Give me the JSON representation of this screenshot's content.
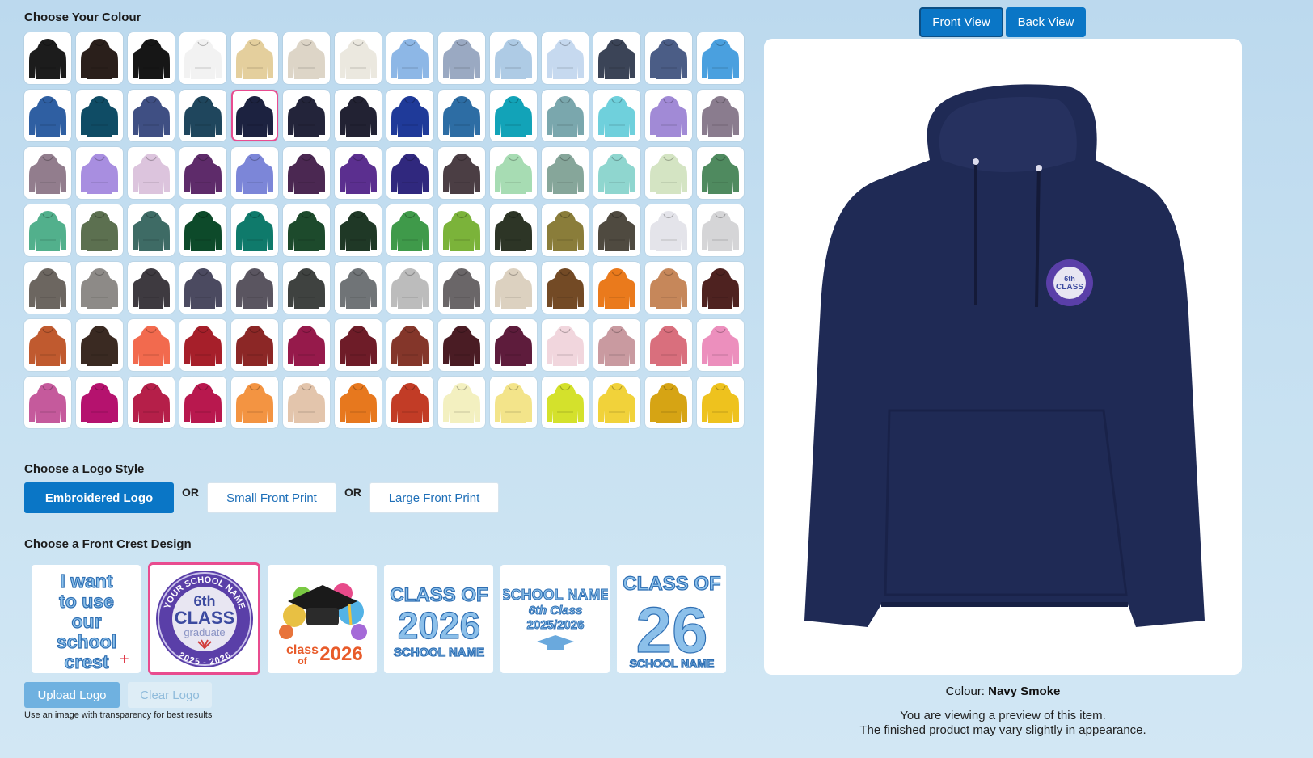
{
  "colour_section": {
    "heading": "Choose Your Colour",
    "selected_index": 18,
    "swatches": [
      "#1c1c1c",
      "#2a1f1b",
      "#161616",
      "#f2f2f2",
      "#e4cf9d",
      "#ddd5c7",
      "#ebe8df",
      "#8db7e6",
      "#9aa9c2",
      "#aecbe5",
      "#c6d9ef",
      "#3b4457",
      "#4b5d86",
      "#4aa0df",
      "#2f5fa2",
      "#0f4c65",
      "#3f4f83",
      "#1f465d",
      "#1c2240",
      "#23243a",
      "#222233",
      "#1f3a99",
      "#2d6da4",
      "#12a3b8",
      "#7aa7ad",
      "#6fd0dc",
      "#a18ad6",
      "#8a7c8e",
      "#927d8d",
      "#a88ee0",
      "#dcc4dd",
      "#5e2b6a",
      "#7c86d8",
      "#4b2852",
      "#5b2f8f",
      "#30287e",
      "#4b3e44",
      "#a7dcb3",
      "#86a69a",
      "#8fd6cf",
      "#d4e4c3",
      "#4f8a5f",
      "#52b08c",
      "#5c7050",
      "#3e6b65",
      "#0d4a2a",
      "#0f7a6b",
      "#1d4a2c",
      "#1f3826",
      "#3f9a4a",
      "#7bb33a",
      "#2d3526",
      "#8a7d3a",
      "#4f4a40",
      "#e4e4ea",
      "#d5d5d7",
      "#6c6660",
      "#8d8a87",
      "#3e3a40",
      "#4b4a60",
      "#5a5560",
      "#3f4240",
      "#707477",
      "#bcbcbc",
      "#6a6668",
      "#dcd1c0",
      "#734a25",
      "#ea7a1c",
      "#c6875a",
      "#4e2220",
      "#c05a2f",
      "#3a2a22",
      "#f26a4e",
      "#a61f2a",
      "#8c2726",
      "#961a4b",
      "#6e1c28",
      "#84362a",
      "#4a1c24",
      "#5e1c3c",
      "#f1d6dd",
      "#c99aa0",
      "#d96f7d",
      "#ec8fbd",
      "#c55a9c",
      "#b5126e",
      "#b51f49",
      "#b8184e",
      "#f39442",
      "#e3c5ac",
      "#e7781e",
      "#c23c26",
      "#f3f0c0",
      "#f3e48a",
      "#d4e12c",
      "#f1d23a",
      "#d6a414",
      "#eec21e"
    ]
  },
  "logo_style": {
    "heading": "Choose a Logo Style",
    "or_label": "OR",
    "options": [
      "Embroidered Logo",
      "Small Front Print",
      "Large Front Print"
    ],
    "selected": "Embroidered Logo"
  },
  "crest_section": {
    "heading": "Choose a Front Crest Design",
    "selected_index": 1,
    "designs": [
      {
        "lines": [
          "I want",
          "to use",
          "our",
          "school",
          "crest"
        ]
      },
      {
        "top_arc": "YOUR SCHOOL NAME",
        "line1": "6th",
        "line2": "CLASS",
        "line3": "graduate",
        "bottom_arc": "2025 - 2026"
      },
      {
        "line1": "class",
        "line2": "of",
        "line3": "2026"
      },
      {
        "line1": "CLASS OF",
        "line2": "2026",
        "line3": "SCHOOL NAME"
      },
      {
        "line1": "SCHOOL NAME",
        "line2": "6th Class",
        "line3": "2025/2026"
      },
      {
        "line1": "CLASS OF",
        "line2": "26",
        "line3": "SCHOOL NAME"
      }
    ],
    "upload_label": "Upload Logo",
    "clear_label": "Clear Logo",
    "hint": "Use an image with transparency for best results"
  },
  "preview": {
    "front_label": "Front View",
    "back_label": "Back View",
    "active_view": "Front View",
    "colour_label": "Colour:",
    "colour_name": "Navy Smoke",
    "hoodie_color": "#1f2a55",
    "note_line1": "You are viewing a preview of this item.",
    "note_line2": "The finished product may vary slightly in appearance."
  }
}
